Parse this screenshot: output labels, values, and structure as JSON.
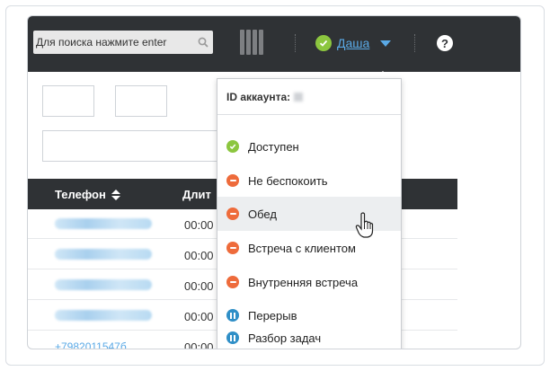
{
  "search": {
    "placeholder": "Для поиска нажмите enter",
    "icon": "search-icon"
  },
  "user": {
    "name": "Даша",
    "status_color": "#8cc63f"
  },
  "help": {
    "label": "?"
  },
  "filters": {
    "dash": "-"
  },
  "table": {
    "headers": {
      "phone": "Телефон",
      "duration": "Длит"
    },
    "rows": [
      {
        "duration": "00:00"
      },
      {
        "duration": "00:00"
      },
      {
        "duration": "00:00"
      },
      {
        "duration": "00:00"
      },
      {
        "phone": "+7982011547б",
        "duration": "00:00"
      }
    ]
  },
  "dropdown": {
    "account_label": "ID аккаунта:",
    "items": [
      {
        "label": "Доступен",
        "color": "green"
      },
      {
        "label": "Не беспокоить",
        "color": "red"
      },
      {
        "label": "Обед",
        "color": "red"
      },
      {
        "label": "Встреча с клиентом",
        "color": "red"
      },
      {
        "label": "Внутренняя встреча",
        "color": "red"
      },
      {
        "label": "Перерыв",
        "color": "blue"
      },
      {
        "label": "Разбор задач",
        "color": "blue"
      }
    ]
  },
  "colors": {
    "topbar": "#2f3235",
    "link": "#5aa9e6",
    "available": "#8cc63f",
    "busy": "#ee6b3b",
    "pause": "#2f8fc7"
  }
}
